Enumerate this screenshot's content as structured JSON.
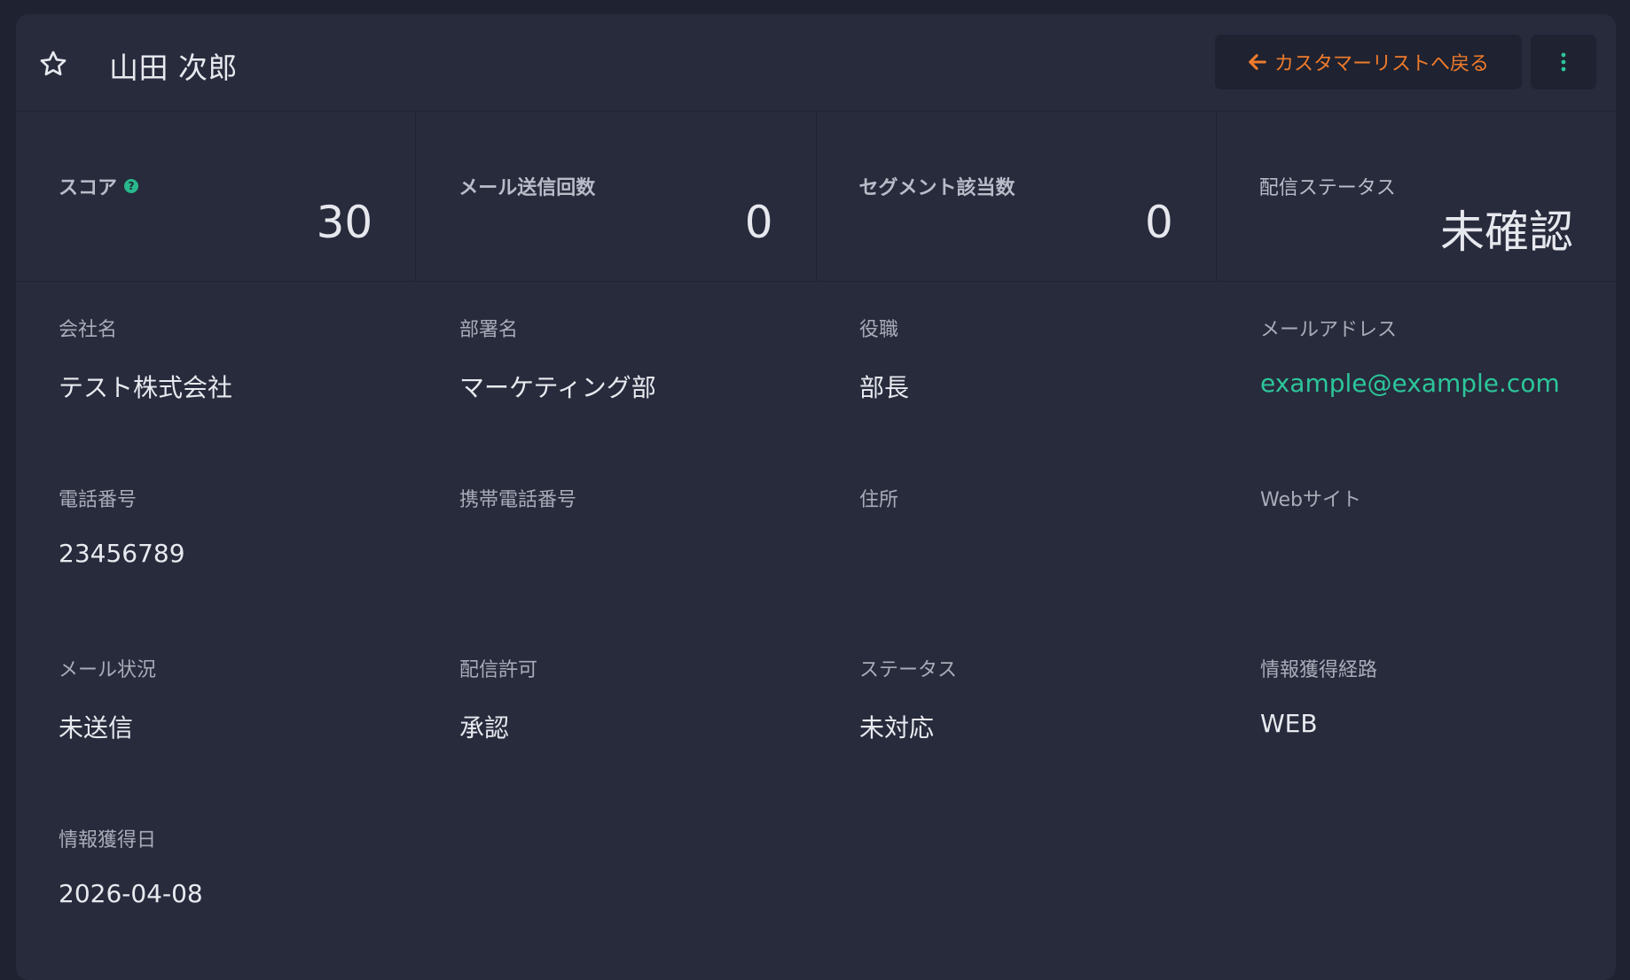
{
  "header": {
    "title": "山田 次郎",
    "back_label": "カスタマーリストへ戻る"
  },
  "stats": [
    {
      "label": "スコア",
      "value": "30"
    },
    {
      "label": "メール送信回数",
      "value": "0"
    },
    {
      "label": "セグメント該当数",
      "value": "0"
    },
    {
      "label": "配信ステータス",
      "value": "未確認"
    }
  ],
  "fields": {
    "company": {
      "label": "会社名",
      "value": "テスト株式会社"
    },
    "department": {
      "label": "部署名",
      "value": "マーケティング部"
    },
    "position": {
      "label": "役職",
      "value": "部長"
    },
    "email": {
      "label": "メールアドレス",
      "value": "example@example.com"
    },
    "phone": {
      "label": "電話番号",
      "value": "23456789"
    },
    "mobile": {
      "label": "携帯電話番号",
      "value": ""
    },
    "address": {
      "label": "住所",
      "value": ""
    },
    "website": {
      "label": "Webサイト",
      "value": ""
    },
    "mail_status": {
      "label": "メール状況",
      "value": "未送信"
    },
    "delivery_permission": {
      "label": "配信許可",
      "value": "承認"
    },
    "status": {
      "label": "ステータス",
      "value": "未対応"
    },
    "source": {
      "label": "情報獲得経路",
      "value": "WEB"
    },
    "acquired_date": {
      "label": "情報獲得日",
      "value": "2026-04-08"
    }
  },
  "icons": {
    "star": "star-outline-icon",
    "back": "arrow-left-icon",
    "more": "kebab-menu-icon",
    "help": "question-circle-icon"
  },
  "colors": {
    "accent_orange": "#ef7b2c",
    "accent_green": "#2cc69a",
    "card_bg": "#282b3c",
    "page_bg": "#1f2230"
  }
}
